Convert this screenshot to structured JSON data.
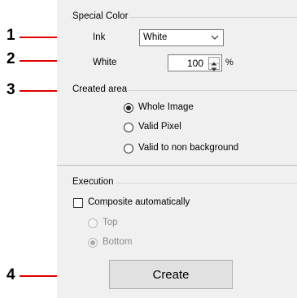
{
  "special_color": {
    "legend": "Special Color",
    "ink_label": "Ink",
    "ink_value": "White",
    "white_label": "White",
    "white_value": "100",
    "white_unit": "%"
  },
  "created_area": {
    "legend": "Created area",
    "options": [
      {
        "label": "Whole Image",
        "selected": true
      },
      {
        "label": "Valid Pixel",
        "selected": false
      },
      {
        "label": "Valid to non background",
        "selected": false
      }
    ]
  },
  "execution": {
    "legend": "Execution",
    "composite_label": "Composite automatically",
    "composite_checked": false,
    "options": [
      {
        "label": "Top",
        "selected": false,
        "enabled": false
      },
      {
        "label": "Bottom",
        "selected": true,
        "enabled": false
      }
    ],
    "create_label": "Create"
  },
  "callouts": [
    "1",
    "2",
    "3",
    "4"
  ],
  "colors": {
    "callout": "#e10000",
    "panel_bg": "#f0f0f0"
  }
}
